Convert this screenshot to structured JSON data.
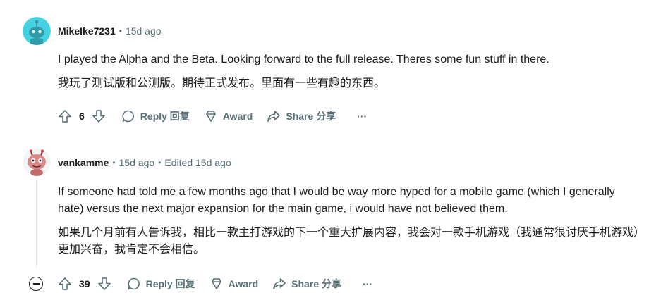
{
  "comments": [
    {
      "username": "MikeIke7231",
      "time": "15d ago",
      "body_en": "I played the Alpha and the Beta. Looking forward to the full release. Theres some fun stuff in there.",
      "body_zh": "我玩了测试版和公测版。期待正式发布。里面有一些有趣的东西。",
      "score": "6",
      "reply_label": "Reply 回复",
      "award_label": "Award",
      "share_label": "Share 分享",
      "more_label": "···",
      "avatar_icon": "reddit-snoo-avatar-icon"
    },
    {
      "username": "vankamme",
      "time": "15d ago",
      "edited": "Edited 15d ago",
      "body_en": "If someone had told me a few months ago that I would be way more hyped for a mobile game (which I generally hate) versus the next major expansion for the main game, i would have not believed them.",
      "body_zh": "如果几个月前有人告诉我，相比一款主打游戏的下一个重大扩展内容，我会对一款手机游戏（我通常很讨厌手机游戏）更加兴奋，我肯定不会相信。",
      "score": "39",
      "reply_label": "Reply 回复",
      "award_label": "Award",
      "share_label": "Share 分享",
      "more_label": "···",
      "avatar_icon": "pink-creature-avatar-icon"
    }
  ],
  "colors": {
    "text": "#1c1c1c",
    "muted": "#576f76",
    "avatar1_bg": "#46d1e0",
    "thread_line": "#e5ebee"
  }
}
